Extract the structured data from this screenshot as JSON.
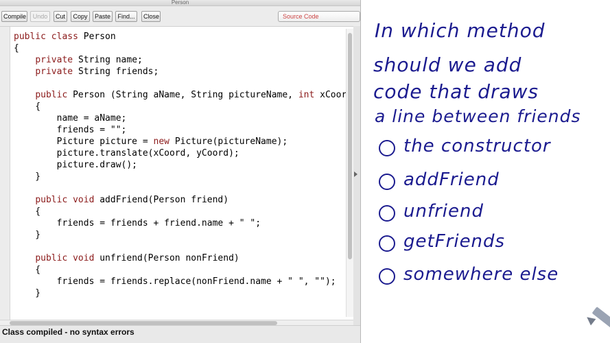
{
  "window": {
    "title": "Person"
  },
  "toolbar": {
    "compile": "Compile",
    "undo": "Undo",
    "cut": "Cut",
    "copy": "Copy",
    "paste": "Paste",
    "find": "Find...",
    "close": "Close",
    "view_select": "Source Code"
  },
  "editor": {
    "lines": [
      [
        [
          "kw",
          "public class "
        ],
        [
          "",
          "Person"
        ]
      ],
      [
        [
          "",
          "{"
        ]
      ],
      [
        [
          "",
          "    "
        ],
        [
          "kw",
          "private "
        ],
        [
          "",
          "String name;"
        ]
      ],
      [
        [
          "",
          "    "
        ],
        [
          "kw",
          "private "
        ],
        [
          "",
          "String friends;"
        ]
      ],
      [
        [
          "",
          ""
        ]
      ],
      [
        [
          "",
          "    "
        ],
        [
          "kw",
          "public "
        ],
        [
          "",
          "Person (String aName, String pictureName, "
        ],
        [
          "kw",
          "int "
        ],
        [
          "",
          "xCoor"
        ]
      ],
      [
        [
          "",
          "    {"
        ]
      ],
      [
        [
          "",
          "        name = aName;"
        ]
      ],
      [
        [
          "",
          "        friends = \"\";"
        ]
      ],
      [
        [
          "",
          "        Picture picture = "
        ],
        [
          "kw",
          "new "
        ],
        [
          "",
          "Picture(pictureName);"
        ]
      ],
      [
        [
          "",
          "        picture.translate(xCoord, yCoord);"
        ]
      ],
      [
        [
          "",
          "        picture.draw();"
        ]
      ],
      [
        [
          "",
          "    }"
        ]
      ],
      [
        [
          "",
          ""
        ]
      ],
      [
        [
          "",
          "    "
        ],
        [
          "kw",
          "public void "
        ],
        [
          "",
          "addFriend(Person friend)"
        ]
      ],
      [
        [
          "",
          "    {"
        ]
      ],
      [
        [
          "",
          "        friends = friends + friend.name + \" \";"
        ]
      ],
      [
        [
          "",
          "    }"
        ]
      ],
      [
        [
          "",
          ""
        ]
      ],
      [
        [
          "",
          "    "
        ],
        [
          "kw",
          "public void "
        ],
        [
          "",
          "unfriend(Person nonFriend)"
        ]
      ],
      [
        [
          "",
          "    {"
        ]
      ],
      [
        [
          "",
          "        friends = friends.replace(nonFriend.name + \" \", \"\");"
        ]
      ],
      [
        [
          "",
          "    }"
        ]
      ]
    ]
  },
  "status": {
    "text": "Class compiled - no syntax errors"
  },
  "board": {
    "question": [
      "In which method",
      "should we add",
      "code that draws",
      "a line between friends"
    ],
    "options": [
      "the constructor",
      "addFriend",
      "unfriend",
      "getFriends",
      "somewhere else"
    ]
  },
  "colors": {
    "keyword": "#8b1a1a",
    "ink": "#1b1b8f"
  }
}
